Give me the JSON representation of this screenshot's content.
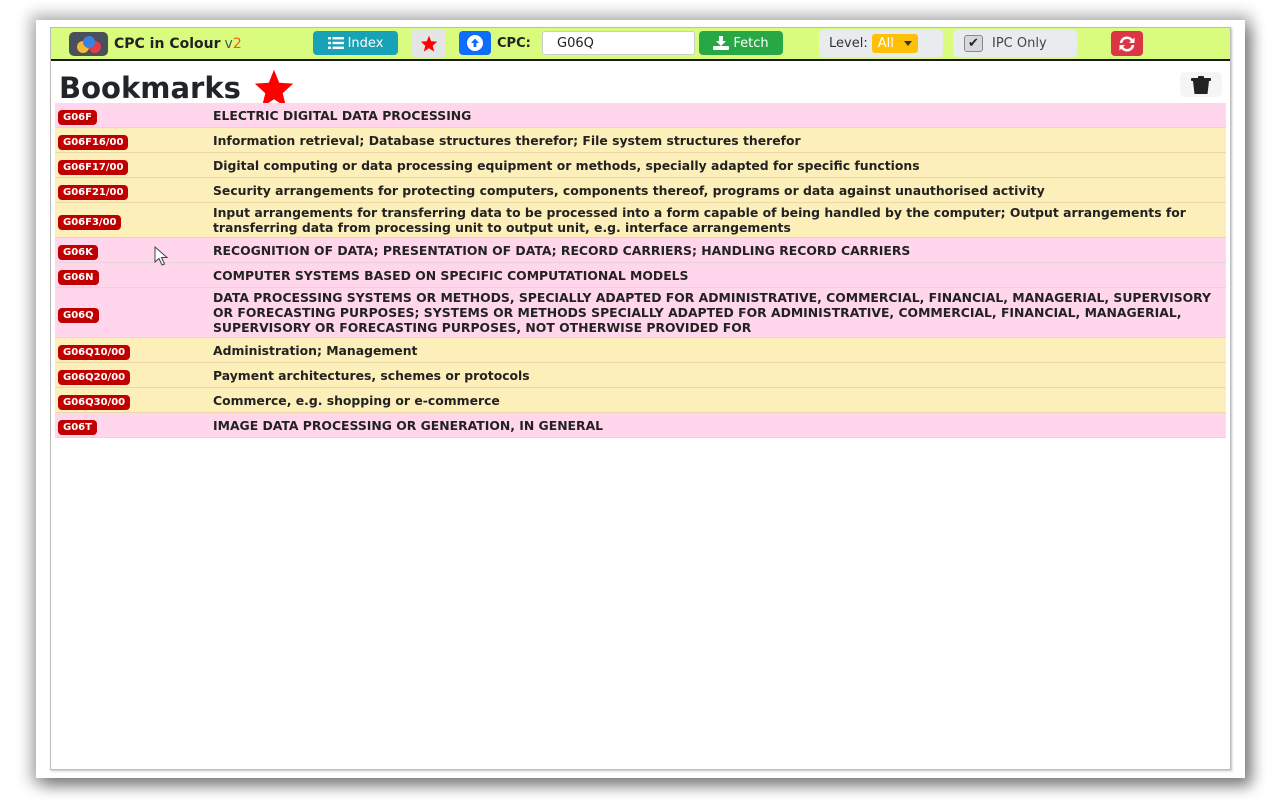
{
  "app": {
    "name": "CPC in Colour",
    "version_prefix": "v",
    "version_number": "2"
  },
  "toolbar": {
    "index_label": "Index",
    "cpc_label": "CPC:",
    "cpc_value": "G06Q",
    "fetch_label": "Fetch",
    "level_label": "Level:",
    "level_selected": "All",
    "ipc_only_label": "IPC Only",
    "ipc_only_checked": true,
    "checkmark": "✔"
  },
  "page": {
    "title": "Bookmarks"
  },
  "colors": {
    "navbar_bg": "#d9fb7e",
    "section_row": "#ffd6ec",
    "group_row": "#fdefba",
    "badge": "#c00000",
    "index_button": "#17a2b8",
    "upload_button": "#0d6efd",
    "fetch_button": "#28a745",
    "level_select": "#ffc107",
    "refresh_button": "#dc3545",
    "star": "#ff0000"
  },
  "bookmarks": [
    {
      "code": "G06F",
      "kind": "pink",
      "title": "ELECTRIC DIGITAL DATA PROCESSING"
    },
    {
      "code": "G06F16/00",
      "kind": "yellow",
      "title": "Information retrieval; Database structures therefor; File system structures therefor"
    },
    {
      "code": "G06F17/00",
      "kind": "yellow",
      "title": "Digital computing or data processing equipment or methods, specially adapted for specific functions"
    },
    {
      "code": "G06F21/00",
      "kind": "yellow",
      "title": "Security arrangements for protecting computers, components thereof, programs or data against unauthorised activity"
    },
    {
      "code": "G06F3/00",
      "kind": "yellow",
      "title": "Input arrangements for transferring data to be processed into a form capable of being handled by the computer; Output arrangements for transferring data from processing unit to output unit, e.g. interface arrangements"
    },
    {
      "code": "G06K",
      "kind": "pink",
      "title": "RECOGNITION OF DATA; PRESENTATION OF DATA; RECORD CARRIERS; HANDLING RECORD CARRIERS"
    },
    {
      "code": "G06N",
      "kind": "pink",
      "title": "COMPUTER SYSTEMS BASED ON SPECIFIC COMPUTATIONAL MODELS"
    },
    {
      "code": "G06Q",
      "kind": "pink",
      "title": "DATA PROCESSING SYSTEMS OR METHODS, SPECIALLY ADAPTED FOR ADMINISTRATIVE, COMMERCIAL, FINANCIAL, MANAGERIAL, SUPERVISORY OR FORECASTING PURPOSES; SYSTEMS OR METHODS SPECIALLY ADAPTED FOR ADMINISTRATIVE, COMMERCIAL, FINANCIAL, MANAGERIAL, SUPERVISORY OR FORECASTING PURPOSES, NOT OTHERWISE PROVIDED FOR"
    },
    {
      "code": "G06Q10/00",
      "kind": "yellow",
      "title": "Administration; Management"
    },
    {
      "code": "G06Q20/00",
      "kind": "yellow",
      "title": "Payment architectures, schemes or protocols"
    },
    {
      "code": "G06Q30/00",
      "kind": "yellow",
      "title": "Commerce, e.g. shopping or e-commerce"
    },
    {
      "code": "G06T",
      "kind": "pink",
      "title": "IMAGE DATA PROCESSING OR GENERATION, IN GENERAL"
    }
  ]
}
